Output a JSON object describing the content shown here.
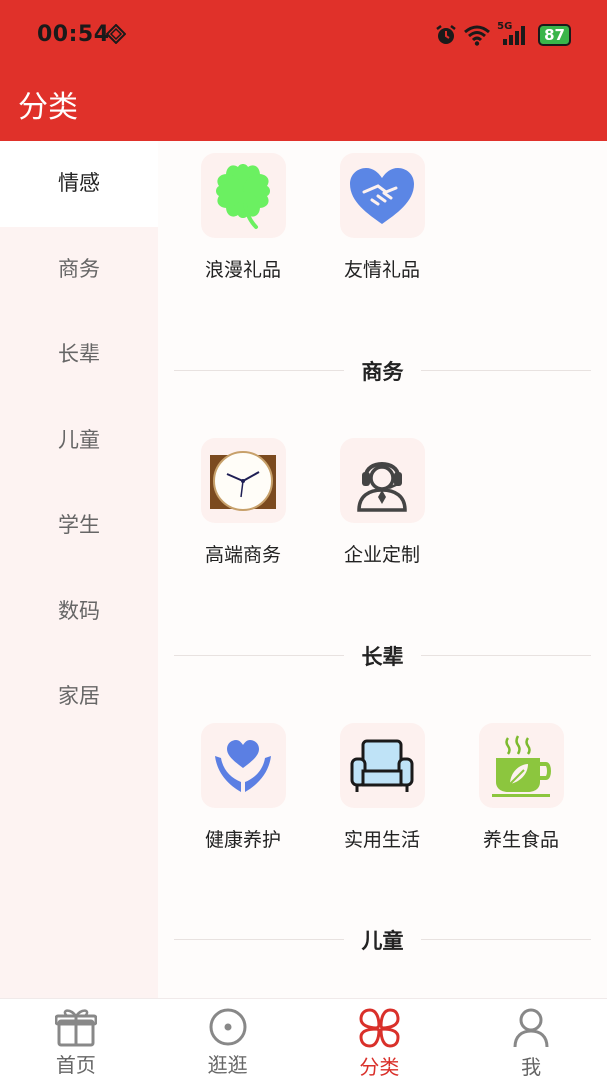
{
  "status": {
    "time": "00:54",
    "network": "5G",
    "battery": "87"
  },
  "header": {
    "title": "分类"
  },
  "sidebar": {
    "items": [
      {
        "label": "情感",
        "active": true
      },
      {
        "label": "商务"
      },
      {
        "label": "长辈"
      },
      {
        "label": "儿童"
      },
      {
        "label": "学生"
      },
      {
        "label": "数码"
      },
      {
        "label": "家居"
      }
    ]
  },
  "sections": {
    "emotion": {
      "items": [
        {
          "label": "浪漫礼品",
          "icon": "clover-icon"
        },
        {
          "label": "友情礼品",
          "icon": "handshake-heart-icon"
        }
      ]
    },
    "business": {
      "title": "商务",
      "items": [
        {
          "label": "高端商务",
          "icon": "clock-icon"
        },
        {
          "label": "企业定制",
          "icon": "headset-agent-icon"
        }
      ]
    },
    "elder": {
      "title": "长辈",
      "items": [
        {
          "label": "健康养护",
          "icon": "hands-heart-icon"
        },
        {
          "label": "实用生活",
          "icon": "armchair-icon"
        },
        {
          "label": "养生食品",
          "icon": "tea-cup-icon"
        }
      ]
    },
    "kids": {
      "title": "儿童"
    }
  },
  "tabbar": {
    "items": [
      {
        "label": "首页",
        "icon": "gift-icon"
      },
      {
        "label": "逛逛",
        "icon": "compass-icon"
      },
      {
        "label": "分类",
        "icon": "category-icon",
        "active": true
      },
      {
        "label": "我",
        "icon": "person-icon"
      }
    ]
  },
  "colors": {
    "primary": "#e0312a",
    "sidebar_bg": "#fdf3f2",
    "tile_bg": "#fdf1ef"
  }
}
